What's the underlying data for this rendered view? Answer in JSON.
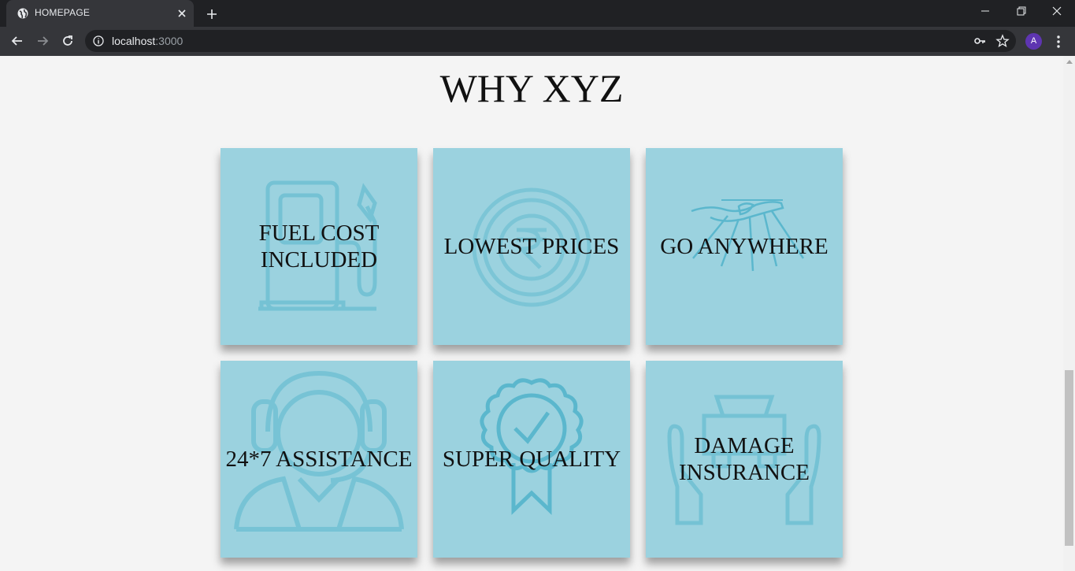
{
  "browser": {
    "tab_title": "HOMEPAGE",
    "url_host": "localhost",
    "url_port": ":3000",
    "avatar_letter": "A"
  },
  "page": {
    "heading": "WHY XYZ",
    "cards": [
      {
        "label": "FUEL COST\nINCLUDED",
        "icon": "fuel-pump-icon"
      },
      {
        "label": "LOWEST PRICES",
        "icon": "rupee-coin-icon"
      },
      {
        "label": "GO ANYWHERE",
        "icon": "car-speed-icon"
      },
      {
        "label": "24*7 ASSISTANCE",
        "icon": "headset-agent-icon"
      },
      {
        "label": "SUPER QUALITY",
        "icon": "quality-badge-icon"
      },
      {
        "label": "DAMAGE\nINSURANCE",
        "icon": "car-insurance-icon"
      }
    ]
  },
  "colors": {
    "card_bg": "#9bd2df",
    "icon_stroke": "#6fc0d3",
    "page_bg": "#f4f4f4"
  }
}
